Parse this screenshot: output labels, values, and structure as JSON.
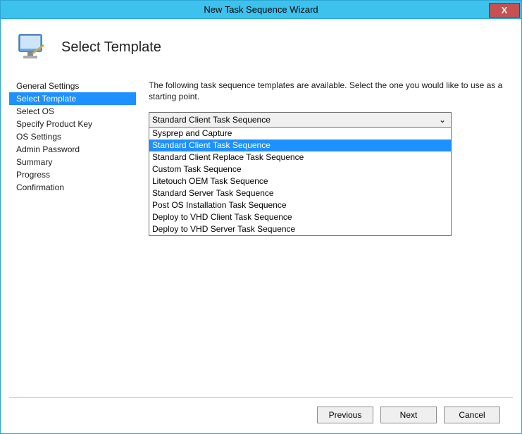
{
  "window": {
    "title": "New Task Sequence Wizard",
    "close_glyph": "X"
  },
  "header": {
    "title": "Select Template"
  },
  "nav": {
    "items": [
      {
        "label": "General Settings"
      },
      {
        "label": "Select Template"
      },
      {
        "label": "Select OS"
      },
      {
        "label": "Specify Product Key"
      },
      {
        "label": "OS Settings"
      },
      {
        "label": "Admin Password"
      },
      {
        "label": "Summary"
      },
      {
        "label": "Progress"
      },
      {
        "label": "Confirmation"
      }
    ],
    "selected_index": 1
  },
  "main": {
    "instruction": "The following task sequence templates are available.  Select the one you would like to use as a starting point.",
    "combo": {
      "selected": "Standard Client Task Sequence",
      "arrow_glyph": "⌄",
      "options": [
        "Sysprep and Capture",
        "Standard Client Task Sequence",
        "Standard Client Replace Task Sequence",
        "Custom Task Sequence",
        "Litetouch OEM Task Sequence",
        "Standard Server Task Sequence",
        "Post OS Installation Task Sequence",
        "Deploy to VHD Client Task Sequence",
        "Deploy to VHD Server Task Sequence"
      ],
      "highlight_index": 1
    }
  },
  "footer": {
    "previous": "Previous",
    "next": "Next",
    "cancel": "Cancel"
  }
}
